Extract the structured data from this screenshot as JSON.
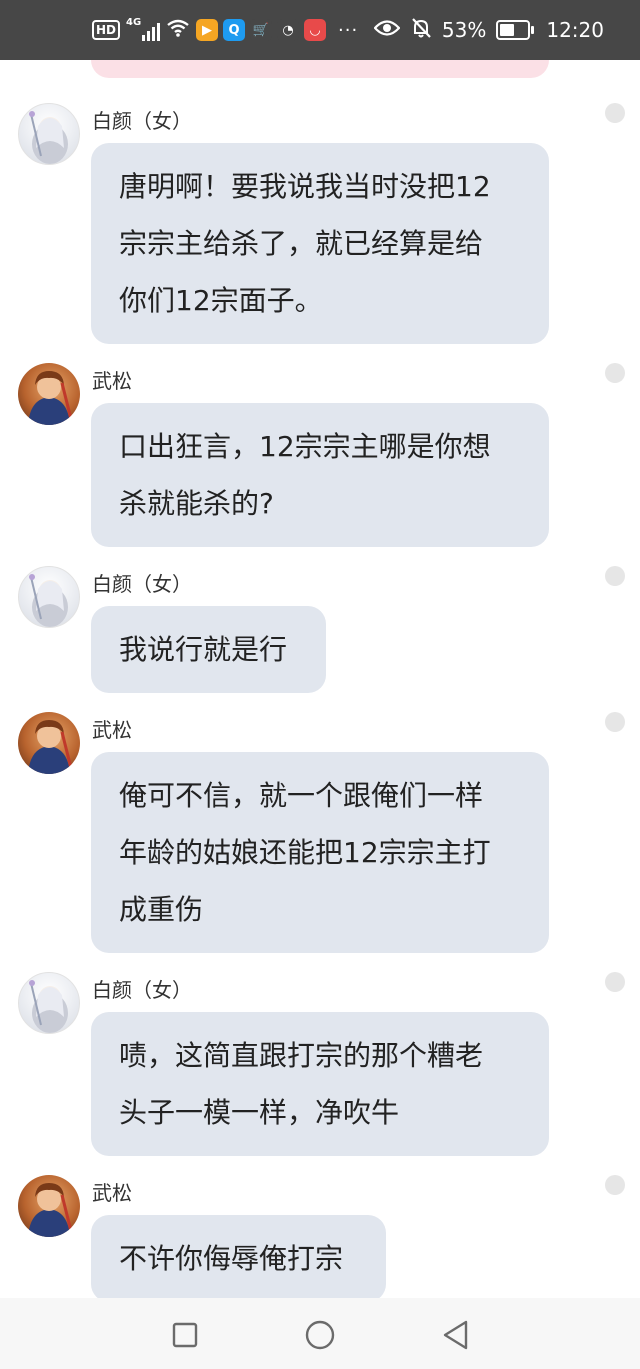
{
  "status_bar": {
    "hd": "HD",
    "network": "4G",
    "battery": "53%",
    "time": "12:20",
    "more": "···",
    "app_icons": [
      {
        "name": "video-app-icon",
        "glyph": "▶",
        "color": "#f5a623"
      },
      {
        "name": "search-app-icon",
        "glyph": "Q",
        "color": "#1e9bf0"
      },
      {
        "name": "shop-app-icon",
        "glyph": "🛒",
        "color": "#474747"
      },
      {
        "name": "ball-app-icon",
        "glyph": "◔",
        "color": "#474747"
      },
      {
        "name": "huawei-mall-icon",
        "glyph": "◡",
        "color": "#e84a4a"
      }
    ]
  },
  "messages": [
    {
      "sender": "白颜（女）",
      "avatar": "bai",
      "lines": [
        "唐明啊！要我说我当时没把12",
        "宗宗主给杀了，就已经算是给",
        "你们12宗面子。"
      ]
    },
    {
      "sender": "武松",
      "avatar": "wu",
      "lines": [
        "口出狂言，12宗宗主哪是你想",
        "杀就能杀的?"
      ]
    },
    {
      "sender": "白颜（女）",
      "avatar": "bai",
      "lines": [
        "我说行就是行"
      ]
    },
    {
      "sender": "武松",
      "avatar": "wu",
      "lines": [
        "俺可不信，就一个跟俺们一样",
        "年龄的姑娘还能把12宗宗主打",
        "成重伤"
      ]
    },
    {
      "sender": "白颜（女）",
      "avatar": "bai",
      "lines": [
        "啧，这简直跟打宗的那个糟老",
        "头子一模一样，净吹牛"
      ]
    },
    {
      "sender": "武松",
      "avatar": "wu",
      "lines": [
        "不许你侮辱俺打宗"
      ]
    }
  ],
  "nav": {
    "buttons": [
      "recent-apps-button",
      "home-button",
      "back-button"
    ]
  },
  "colors": {
    "status_bar": "#474747",
    "bubble": "#e1e6ee",
    "pink_bubble": "#fbe0e6",
    "nav_bar": "#f7f7f7"
  }
}
